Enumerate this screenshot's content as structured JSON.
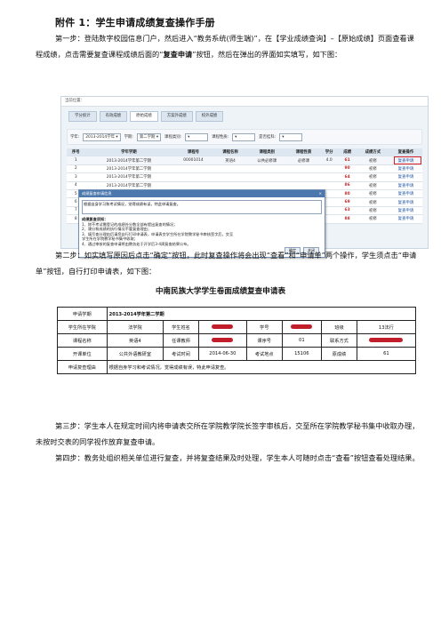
{
  "heading": "附件 1：学生申请成绩复查操作手册",
  "step1": {
    "prefix": "第一步：登陆数字校园信息门户，然后进入“教务系统(师生端)”，在【学业成绩查询】–【原始成绩】页面查看课程成绩，点击需要复查课程成绩后面的“",
    "bold": "复查申请",
    "suffix": "”按钮，然后在弹出的界面如实填写，如下图："
  },
  "screenshot1": {
    "breadcrumb": "当前位置：",
    "tabs": [
      "学分统计",
      "有效成绩",
      "原始成绩",
      "方案外成绩",
      "校外成绩"
    ],
    "active_tab_index": 2,
    "filters": [
      {
        "label": "学年:",
        "value": "2013-2014学年"
      },
      {
        "label": "学期:",
        "value": "第二学期"
      },
      {
        "label": "课程类别:",
        "value": ""
      },
      {
        "label": "课程性质:",
        "value": ""
      },
      {
        "label": "是否挂科:",
        "value": ""
      }
    ],
    "columns": [
      "序号",
      "学年学期",
      "课程号",
      "课程名称",
      "课程类别",
      "课程性质",
      "学分",
      "成绩",
      "成绩方式",
      "复查操作"
    ],
    "rows": [
      [
        "1",
        "2013-2014学年第二学期",
        "00001014",
        "英语4",
        "公共必修课",
        "必修课",
        "4.0",
        "61",
        "初修",
        "复查申请"
      ],
      [
        "2",
        "2013-2014学年第二学期",
        "",
        "",
        "",
        "",
        "",
        "90",
        "初修",
        "复查申请"
      ],
      [
        "3",
        "2013-2014学年第二学期",
        "",
        "",
        "",
        "",
        "",
        "64",
        "初修",
        "复查申请"
      ],
      [
        "4",
        "2013-2014学年第二学期",
        "",
        "",
        "",
        "",
        "",
        "86",
        "初修",
        "复查申请"
      ],
      [
        "5",
        "2013-2014学年第二学期",
        "",
        "",
        "",
        "",
        "",
        "80",
        "初修",
        "复查申请"
      ],
      [
        "6",
        "2013-2014学年第二学期",
        "",
        "",
        "",
        "",
        "",
        "69",
        "初修",
        "复查申请"
      ],
      [
        "7",
        "2013-2014学年第二学期",
        "",
        "",
        "",
        "",
        "",
        "63",
        "初修",
        "复查申请"
      ],
      [
        "8",
        "2013-2014学年第二学期",
        "",
        "",
        "",
        "",
        "",
        "88",
        "初修",
        "复查申请"
      ]
    ],
    "dialog": {
      "title": "成绩复查申请信息",
      "close": "×",
      "textarea": "根据自身学习和考试情况，觉得成绩有误，特此申请复查。",
      "notes": [
        "成绩复查须知：",
        "1、除不考试需登记的成绩外分数全部有提出复查的情况；",
        "2、课分和成绩的执行情况不要复查理由；",
        "3、填写查分理由后请您自行打印申请表，申请表交学生所在学院教学秘书审核签字后，交至",
        "学生所在学院教学秘书集中收取；",
        "4、通过审核的复查申请将由教务处于开学后3-4周复查结果公布。"
      ],
      "buttons": [
        "确定",
        "关闭"
      ]
    }
  },
  "step2": "第二步：如实填写原因后点击“确定”按钮，此时复查操作将会出现“查看”和“申请单”两个操作，学生须点击“申请单”按钮，自行打印申请表，如下图：",
  "form": {
    "title": "中南民族大学学生卷面成绩复查申请表",
    "rows": [
      [
        {
          "t": "申请学期"
        },
        {
          "t": "2013-2014学年第二学期",
          "span": 5,
          "left": true,
          "bold": true
        }
      ],
      [
        {
          "t": "学生所在学院"
        },
        {
          "t": "法学院"
        },
        {
          "t": "学生姓名"
        },
        {
          "t": "",
          "redact": true
        },
        {
          "t": "学号"
        },
        {
          "t": "",
          "redact": true
        },
        {
          "t": "班级"
        },
        {
          "t": "13法行"
        }
      ],
      [
        {
          "t": "课程名称"
        },
        {
          "t": "英语4"
        },
        {
          "t": "任课教师"
        },
        {
          "t": "",
          "redact": true
        },
        {
          "t": "课序号"
        },
        {
          "t": "01"
        },
        {
          "t": "联系方式"
        },
        {
          "t": "",
          "redact": true,
          "long": true
        }
      ],
      [
        {
          "t": "开课单位"
        },
        {
          "t": "公共外语教研室"
        },
        {
          "t": "考试时间"
        },
        {
          "t": "2014-06-30"
        },
        {
          "t": "考试地点"
        },
        {
          "t": "15106"
        },
        {
          "t": "原成绩"
        },
        {
          "t": "61"
        }
      ],
      [
        {
          "t": "申请复查理由"
        },
        {
          "t": "根据自身学习和考试情况，觉得成绩有误，特此申请复查。",
          "span": 7,
          "left": true
        }
      ]
    ]
  },
  "step3": "第三步：学生本人在规定时间内将申请表交所在学院教学院长签字审核后，交至所在学院教学秘书集中收取办理，未按时交表的同学视作放弃复查申请。",
  "step4": "第四步：教务处组织相关单位进行复查，并将复查结果及时处理，学生本人可随时点击“查看”按钮查看处理结果。"
}
